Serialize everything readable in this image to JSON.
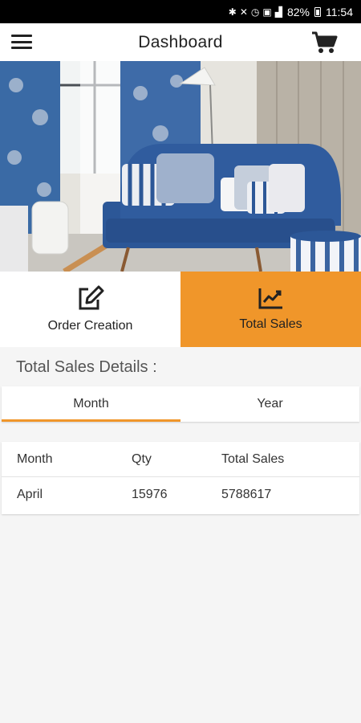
{
  "status_bar": {
    "battery": "82%",
    "time": "11:54",
    "icons": [
      "bluetooth-icon",
      "mute-icon",
      "alarm-icon",
      "nfc-icon",
      "lte-icon",
      "signal-icon",
      "battery-icon"
    ]
  },
  "app_bar": {
    "title": "Dashboard",
    "menu_icon": "hamburger-menu-icon",
    "cart_icon": "shopping-cart-icon"
  },
  "hero": {
    "image": "blue-sofa-living-room-photo"
  },
  "main_tabs": [
    {
      "label": "Order Creation",
      "icon": "edit-icon",
      "active": false
    },
    {
      "label": "Total Sales",
      "icon": "chart-trend-icon",
      "active": true
    }
  ],
  "section": {
    "title": "Total Sales Details :"
  },
  "period_tabs": [
    {
      "label": "Month",
      "selected": true
    },
    {
      "label": "Year",
      "selected": false
    }
  ],
  "table": {
    "columns": [
      "Month",
      "Qty",
      "Total Sales"
    ],
    "rows": [
      [
        "April",
        "15976",
        "5788617"
      ]
    ]
  },
  "colors": {
    "accent": "#f0962a",
    "sofa": "#2f5a9c"
  }
}
